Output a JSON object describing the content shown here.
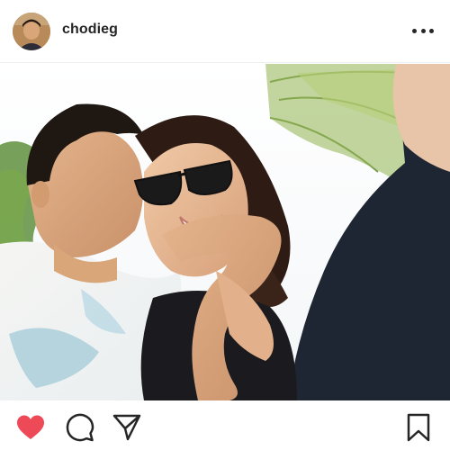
{
  "post": {
    "username": "chodieg",
    "liked": true,
    "colors": {
      "like": "#ed4956",
      "icon": "#262626"
    }
  },
  "icons": {
    "more": "more-options-icon",
    "like": "heart-icon",
    "comment": "comment-icon",
    "share": "share-icon",
    "save": "bookmark-icon"
  }
}
